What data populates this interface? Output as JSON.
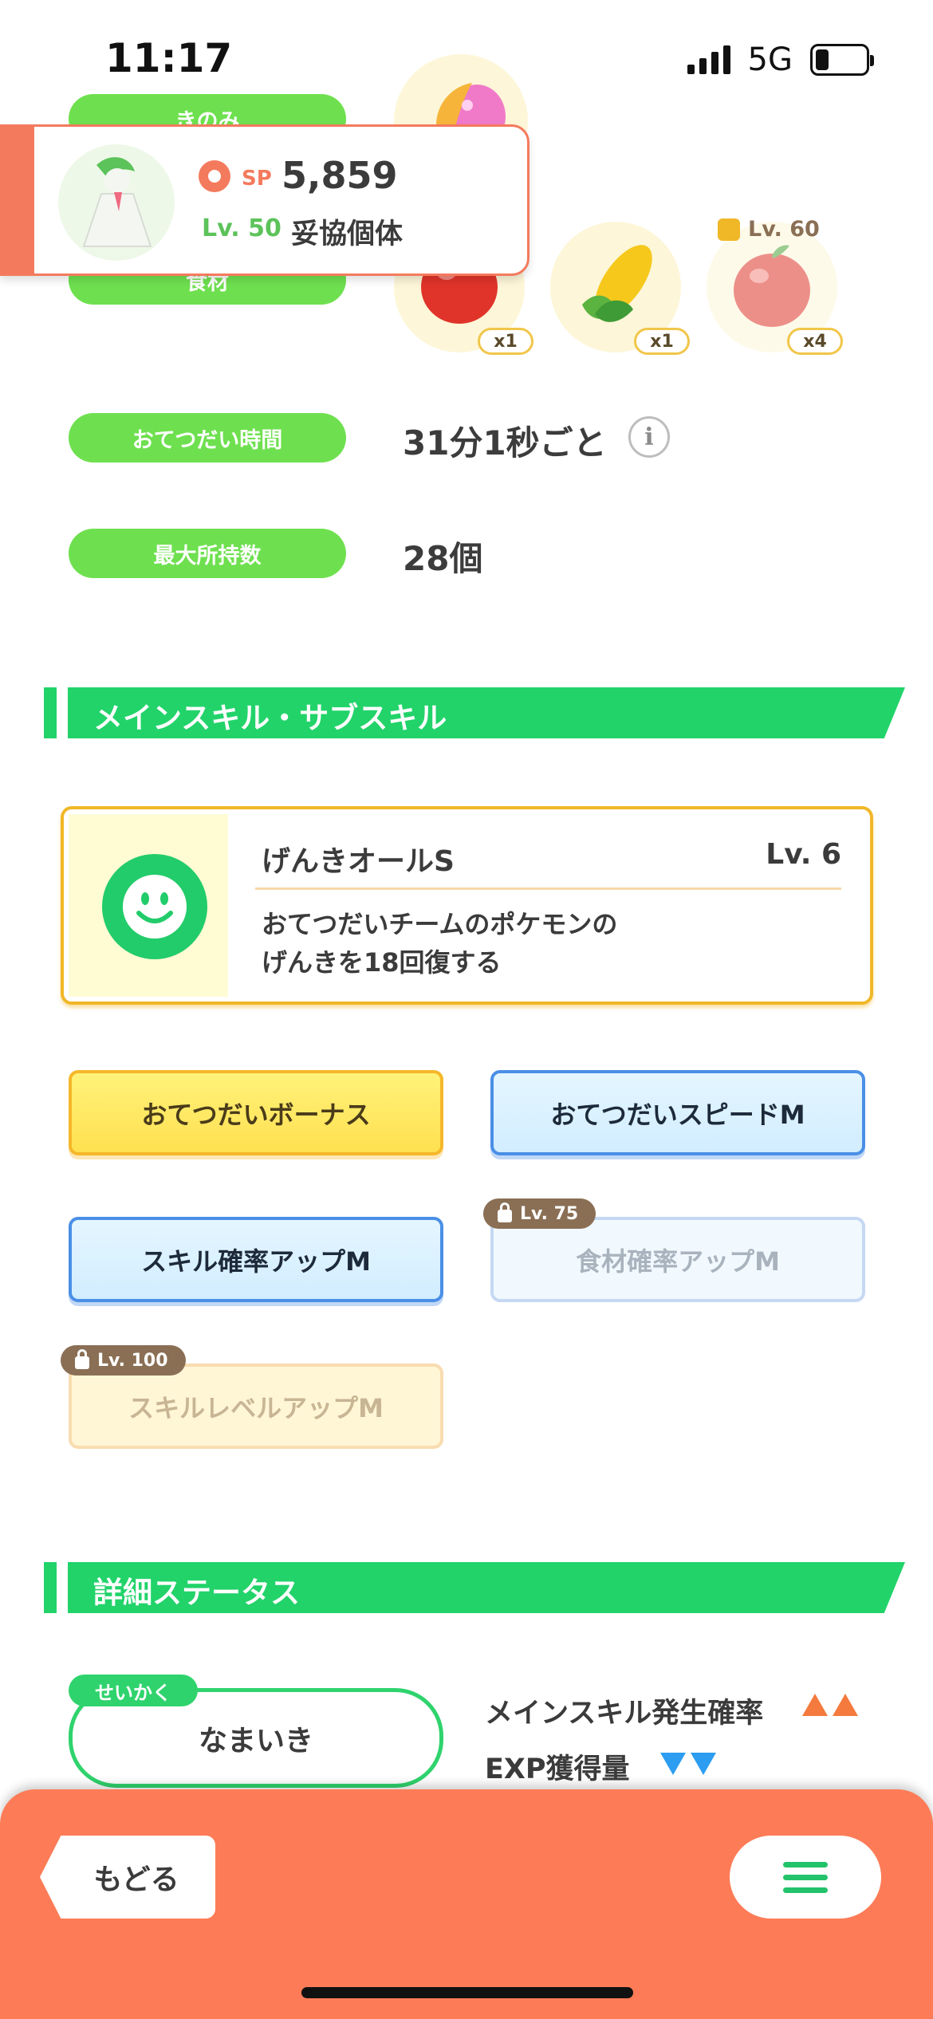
{
  "status_bar": {
    "time": "11:17",
    "network": "5G"
  },
  "labels": {
    "berry": "きのみ",
    "ingredients": "食材",
    "help_time": "おてつだい時間",
    "max_carry": "最大所持数"
  },
  "values": {
    "help_time": "31分1秒ごと",
    "max_carry": "28個",
    "info_glyph": "i"
  },
  "ingredients": [
    {
      "name": "apple-icon",
      "qty": "x1",
      "locked": false
    },
    {
      "name": "corn-icon",
      "qty": "x1",
      "locked": false
    },
    {
      "name": "apple-icon",
      "qty": "x4",
      "locked": true,
      "lock_level": "Lv. 60"
    }
  ],
  "pokemon_card": {
    "sp_label": "SP",
    "sp_value": "5,859",
    "level": "Lv. 50",
    "status": "妥協個体"
  },
  "sections": {
    "skills_title": "メインスキル・サブスキル",
    "detail_title": "詳細ステータス"
  },
  "main_skill": {
    "name": "げんきオールS",
    "level": "Lv. 6",
    "description_line1": "おてつだいチームのポケモンの",
    "description_line2": "げんきを18回復する"
  },
  "sub_skills": [
    {
      "label": "おてつだいボーナス"
    },
    {
      "label": "おてつだいスピードM"
    },
    {
      "label": "スキル確率アップM"
    },
    {
      "label": "食材確率アップM",
      "lock": "Lv. 75"
    },
    {
      "label": "スキルレベルアップM",
      "lock": "Lv. 100"
    }
  ],
  "nature": {
    "tag": "せいかく",
    "value": "なまいき",
    "up_stat": "メインスキル発生確率",
    "down_stat": "EXP獲得量"
  },
  "bottom_bar": {
    "back_label": "もどる"
  },
  "colors": {
    "accent_green": "#22d36a",
    "pill_green": "#6ee04f",
    "coral": "#fd7c57",
    "gold": "#f0b727"
  }
}
